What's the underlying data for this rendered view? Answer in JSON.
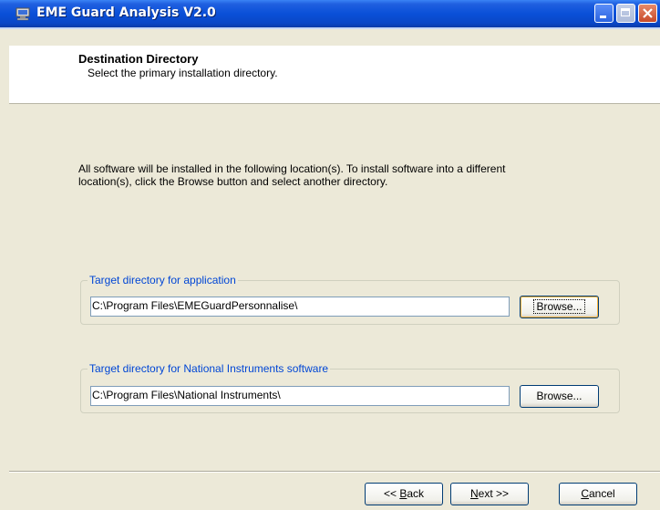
{
  "window": {
    "title": "EME Guard Analysis V2.0",
    "icon": "installer-app-icon"
  },
  "header": {
    "title": "Destination Directory",
    "subtitle": "Select the primary installation directory."
  },
  "description": "All software will be installed in the following location(s). To install software into a different location(s), click the Browse button and select another directory.",
  "groups": [
    {
      "legend": "Target directory for application",
      "path": "C:\\Program Files\\EMEGuardPersonnalise\\",
      "browse_label": "Browse..."
    },
    {
      "legend": "Target directory for National Instruments software",
      "path": "C:\\Program Files\\National Instruments\\",
      "browse_label": "Browse..."
    }
  ],
  "buttons": {
    "back": {
      "prefix": "<< ",
      "mnemonic": "B",
      "rest": "ack"
    },
    "next": {
      "mnemonic": "N",
      "rest": "ext >>"
    },
    "cancel": {
      "mnemonic": "C",
      "rest": "ancel"
    }
  },
  "colors": {
    "titlebar": "#0a50d8",
    "legend_text": "#0046d5",
    "dialog_bg": "#ece9d8"
  }
}
